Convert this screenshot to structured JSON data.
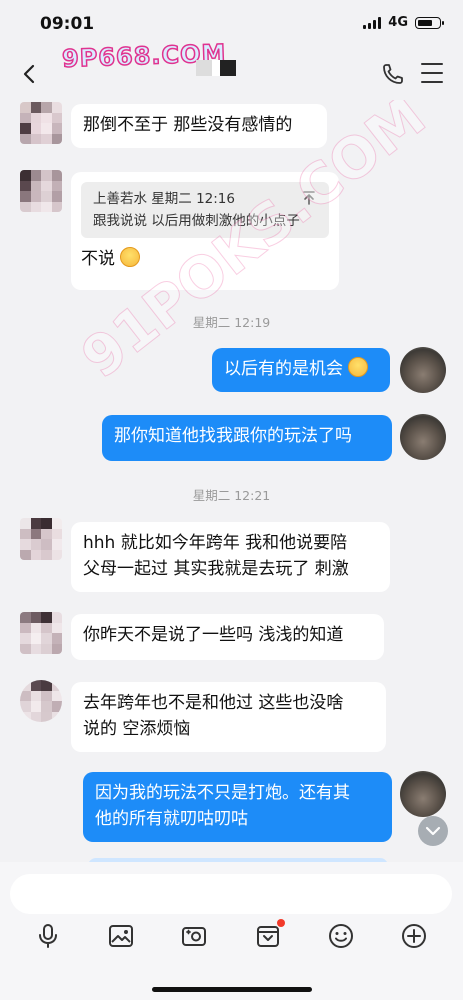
{
  "status": {
    "time": "09:01",
    "network": "4G"
  },
  "header": {
    "watermark": "9P668.COM"
  },
  "watermark_diag": "91POKS.COM",
  "messages": {
    "m1": "那倒不至于 那些没有感情的",
    "m2_quote_author": "上善若水 星期二 12:16",
    "m2_quote_text": "跟我说说 以后用做刺激他的小点子",
    "m2_text": "不说",
    "ts1": "星期二 12:19",
    "m3": "以后有的是机会",
    "m4": "那你知道他找我跟你的玩法了吗",
    "ts2": "星期二 12:21",
    "m5_line1": "hhh 就比如今年跨年 我和他说要陪",
    "m5_line2": "父母一起过 其实我就是去玩了 刺激",
    "m6": "你昨天不是说了一些吗 浅浅的知道",
    "m7_line1": "去年跨年也不是和他过 这些也没啥",
    "m7_line2": "说的 空添烦恼",
    "m8_line1": "因为我的玩法不只是打炮。还有其",
    "m8_line2": "他的所有就叨咕叨咕"
  },
  "colors": {
    "my_bubble": "#1d8cf8",
    "their_bubble": "#ffffff",
    "badge": "#f23a2a"
  },
  "toolbar_icons": [
    "microphone-icon",
    "image-icon",
    "camera-icon",
    "gift-icon",
    "emoji-icon",
    "plus-icon"
  ]
}
